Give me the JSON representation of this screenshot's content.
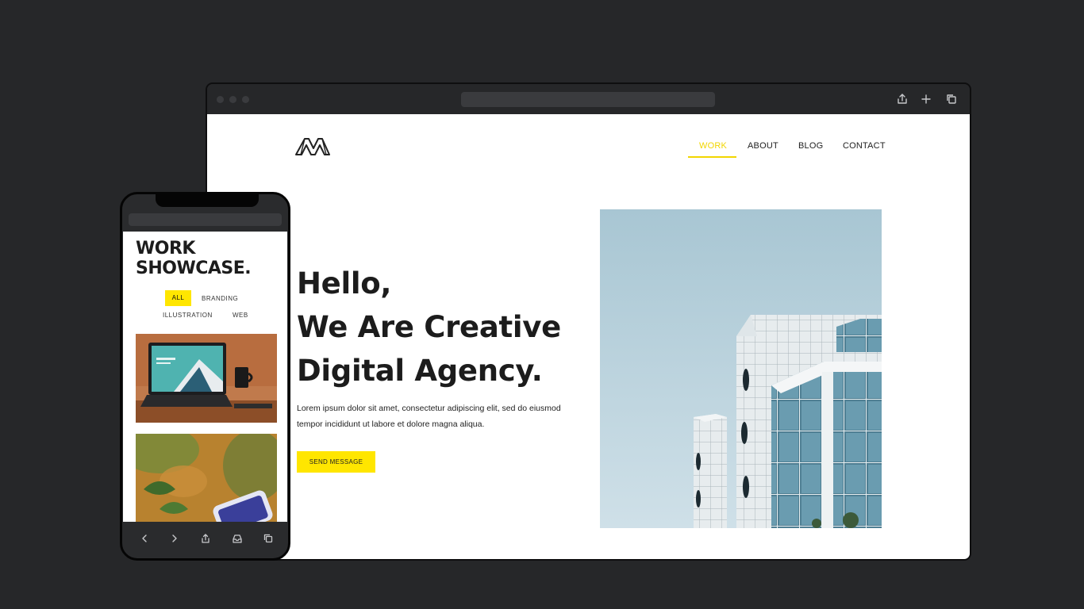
{
  "browser": {
    "toolbar_icons": [
      "share-icon",
      "plus-icon",
      "copy-tabs-icon"
    ]
  },
  "site": {
    "logo": "M-logo",
    "nav": [
      {
        "label": "WORK",
        "active": true
      },
      {
        "label": "ABOUT",
        "active": false
      },
      {
        "label": "BLOG",
        "active": false
      },
      {
        "label": "CONTACT",
        "active": false
      }
    ],
    "hero": {
      "title_line1": "Hello,",
      "title_line2": "We Are Creative",
      "title_line3": "Digital Agency.",
      "body_line1": "Lorem ipsum dolor sit amet, consectetur adipiscing elit, sed do eiusmod",
      "body_line2": "tempor incididunt ut labore et dolore magna aliqua.",
      "button": "SEND MESSAGE",
      "image": "modern glass office building against pale blue sky"
    }
  },
  "phone": {
    "title_line1": "WORK",
    "title_line2": "SHOWCASE.",
    "filters": [
      {
        "label": "ALL",
        "active": true
      },
      {
        "label": "BRANDING",
        "active": false
      },
      {
        "label": "ILLUSTRATION",
        "active": false
      },
      {
        "label": "WEB",
        "active": false
      }
    ],
    "thumbnails": [
      "laptop on desk with coffee mug",
      "phone on wooden table with plant leaves"
    ],
    "toolbar_icons": [
      "back-icon",
      "forward-icon",
      "share-icon",
      "inbox-icon",
      "tabs-icon"
    ]
  },
  "colors": {
    "background": "#262729",
    "accent": "#ffe600",
    "nav_active": "#f2d600",
    "text": "#1c1c1c"
  }
}
